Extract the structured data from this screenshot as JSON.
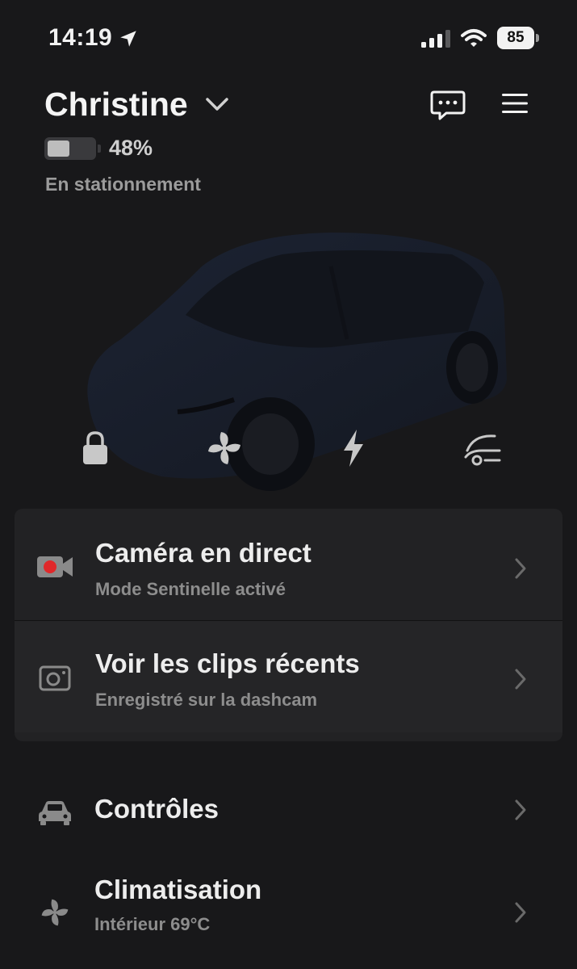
{
  "status_bar": {
    "time": "14:19",
    "battery_level": "85",
    "icons": [
      "location-arrow-icon",
      "cellular-signal-icon",
      "wifi-icon",
      "battery-icon"
    ]
  },
  "vehicle": {
    "name": "Christine",
    "battery_percent": "48%",
    "battery_fill_fraction": 0.48,
    "status": "En stationnement"
  },
  "quick_actions": [
    {
      "icon": "lock-icon"
    },
    {
      "icon": "fan-icon"
    },
    {
      "icon": "lightning-icon"
    },
    {
      "icon": "frunk-open-icon"
    }
  ],
  "camera_card": {
    "live": {
      "title": "Caméra en direct",
      "subtitle": "Mode Sentinelle activé",
      "icon": "video-camera-icon"
    },
    "clips": {
      "title": "Voir les clips récents",
      "subtitle": "Enregistré sur la dashcam",
      "icon": "dashcam-icon"
    }
  },
  "menu": [
    {
      "label": "Contrôles",
      "icon": "car-icon"
    },
    {
      "label": "Climatisation",
      "subtitle": "Intérieur 69°C",
      "icon": "fan-icon"
    }
  ],
  "colors": {
    "background": "#18181a",
    "card": "#222224",
    "recording_red": "#e0282a",
    "muted_text": "#8d8d8d"
  }
}
